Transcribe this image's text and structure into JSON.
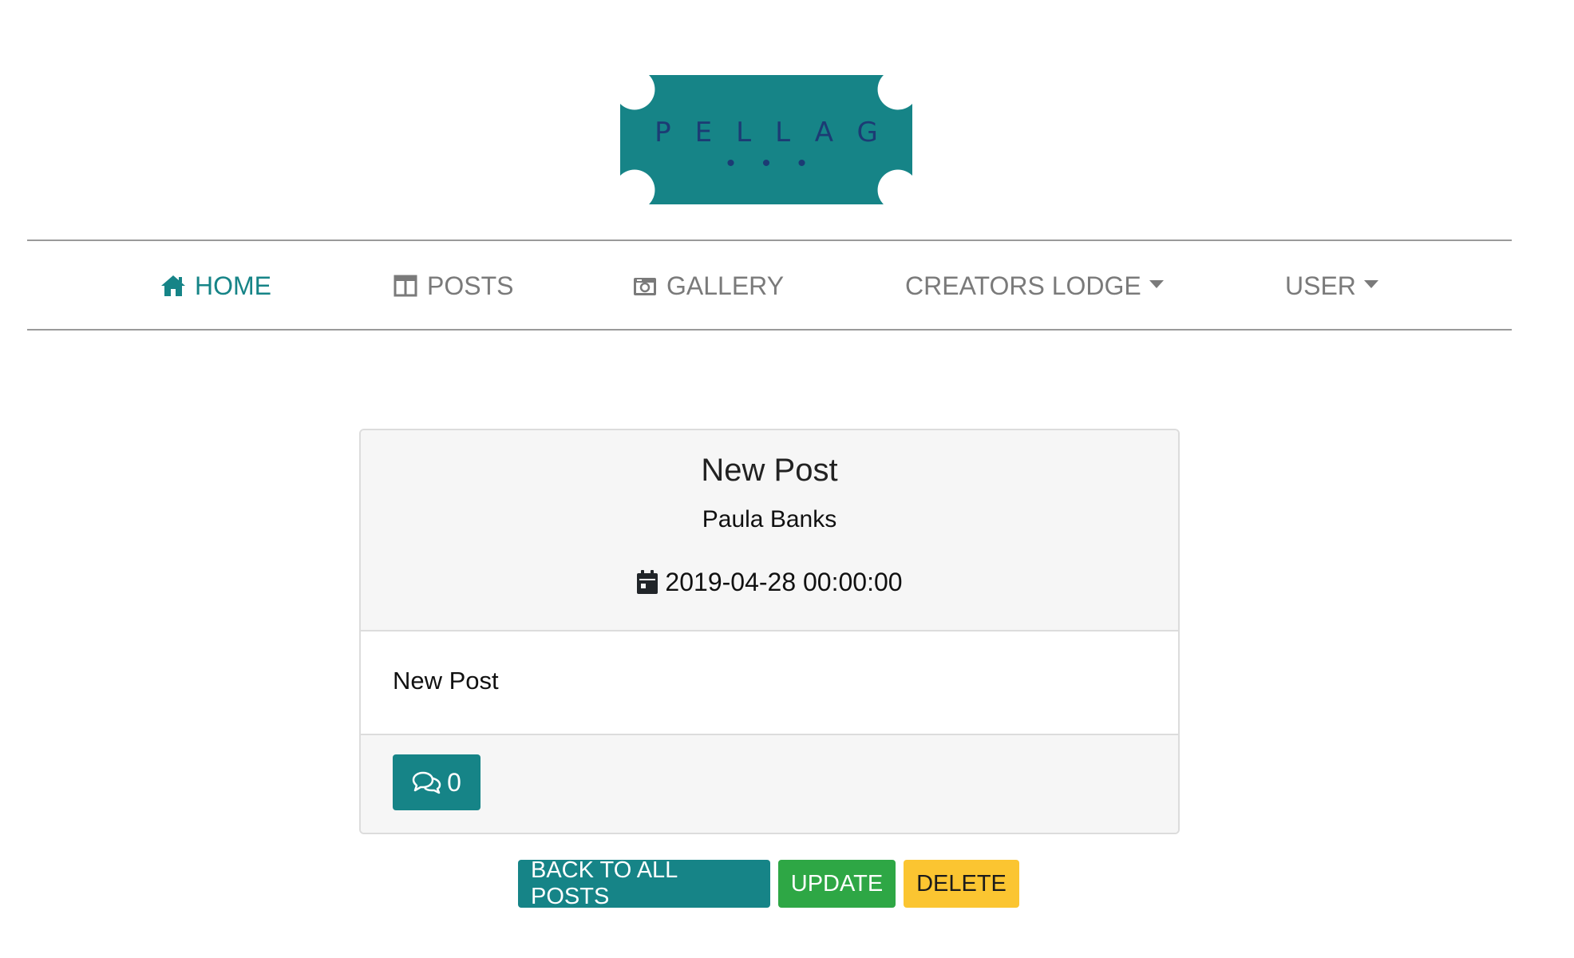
{
  "logo": {
    "text": "PELLAG",
    "dots": "•••",
    "color": "#168487"
  },
  "nav": {
    "home": {
      "label": "HOME",
      "icon": "home-icon"
    },
    "posts": {
      "label": "POSTS",
      "icon": "columns-icon"
    },
    "gallery": {
      "label": "GALLERY",
      "icon": "camera-icon"
    },
    "creators": {
      "label": "CREATORS LODGE",
      "icon": "caret-down-icon"
    },
    "user": {
      "label": "USER",
      "icon": "caret-down-icon"
    }
  },
  "post": {
    "title": "New Post",
    "author": "Paula Banks",
    "date": "2019-04-28 00:00:00",
    "body": "New Post",
    "comment_count": "0"
  },
  "actions": {
    "back_label": "BACK TO ALL POSTS",
    "update_label": "UPDATE",
    "delete_label": "DELETE"
  },
  "colors": {
    "primary": "#168487",
    "success": "#2ea745",
    "warning": "#fbc531",
    "nav_text": "#7a7a7a"
  }
}
